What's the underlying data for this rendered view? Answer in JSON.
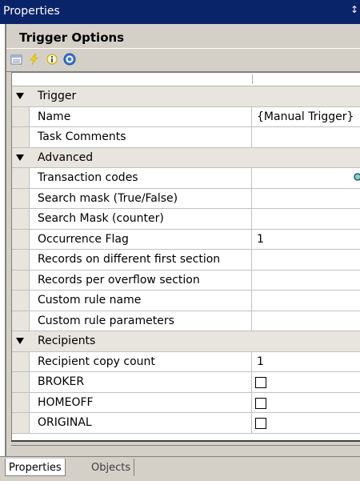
{
  "window": {
    "title": "Properties",
    "pin_glyph": "↕"
  },
  "panel": {
    "title": "Trigger Options"
  },
  "toolbar": {
    "icons": [
      "categorized-icon",
      "lightning-icon",
      "info-icon",
      "help-icon"
    ]
  },
  "grid": {
    "rows": [
      {
        "type": "category",
        "label": "Trigger"
      },
      {
        "type": "property",
        "label": "Name",
        "value": "{Manual Trigger}"
      },
      {
        "type": "property",
        "label": "Task Comments",
        "value": ""
      },
      {
        "type": "category",
        "label": "Advanced"
      },
      {
        "type": "property",
        "label": "Transaction codes",
        "value": "",
        "has_search": true
      },
      {
        "type": "property",
        "label": "Search mask (True/False)",
        "value": ""
      },
      {
        "type": "property",
        "label": "Search Mask (counter)",
        "value": ""
      },
      {
        "type": "property",
        "label": "Occurrence Flag",
        "value": "1"
      },
      {
        "type": "property",
        "label": "Records on different first section",
        "value": ""
      },
      {
        "type": "property",
        "label": "Records per overflow section",
        "value": ""
      },
      {
        "type": "property",
        "label": "Custom rule name",
        "value": ""
      },
      {
        "type": "property",
        "label": "Custom rule parameters",
        "value": ""
      },
      {
        "type": "category",
        "label": "Recipients"
      },
      {
        "type": "property",
        "label": "Recipient copy count",
        "value": "1"
      },
      {
        "type": "property",
        "label": "BROKER",
        "checkbox": true
      },
      {
        "type": "property",
        "label": "HOMEOFF",
        "checkbox": true
      },
      {
        "type": "property",
        "label": "ORIGINAL",
        "checkbox": true
      }
    ]
  },
  "tabs": [
    {
      "label": "Properties",
      "active": true
    },
    {
      "label": "Objects",
      "active": false
    }
  ],
  "colors": {
    "titlebar": "#0a246a",
    "chrome": "#d4d0c8",
    "category": "#e7e5dd"
  }
}
